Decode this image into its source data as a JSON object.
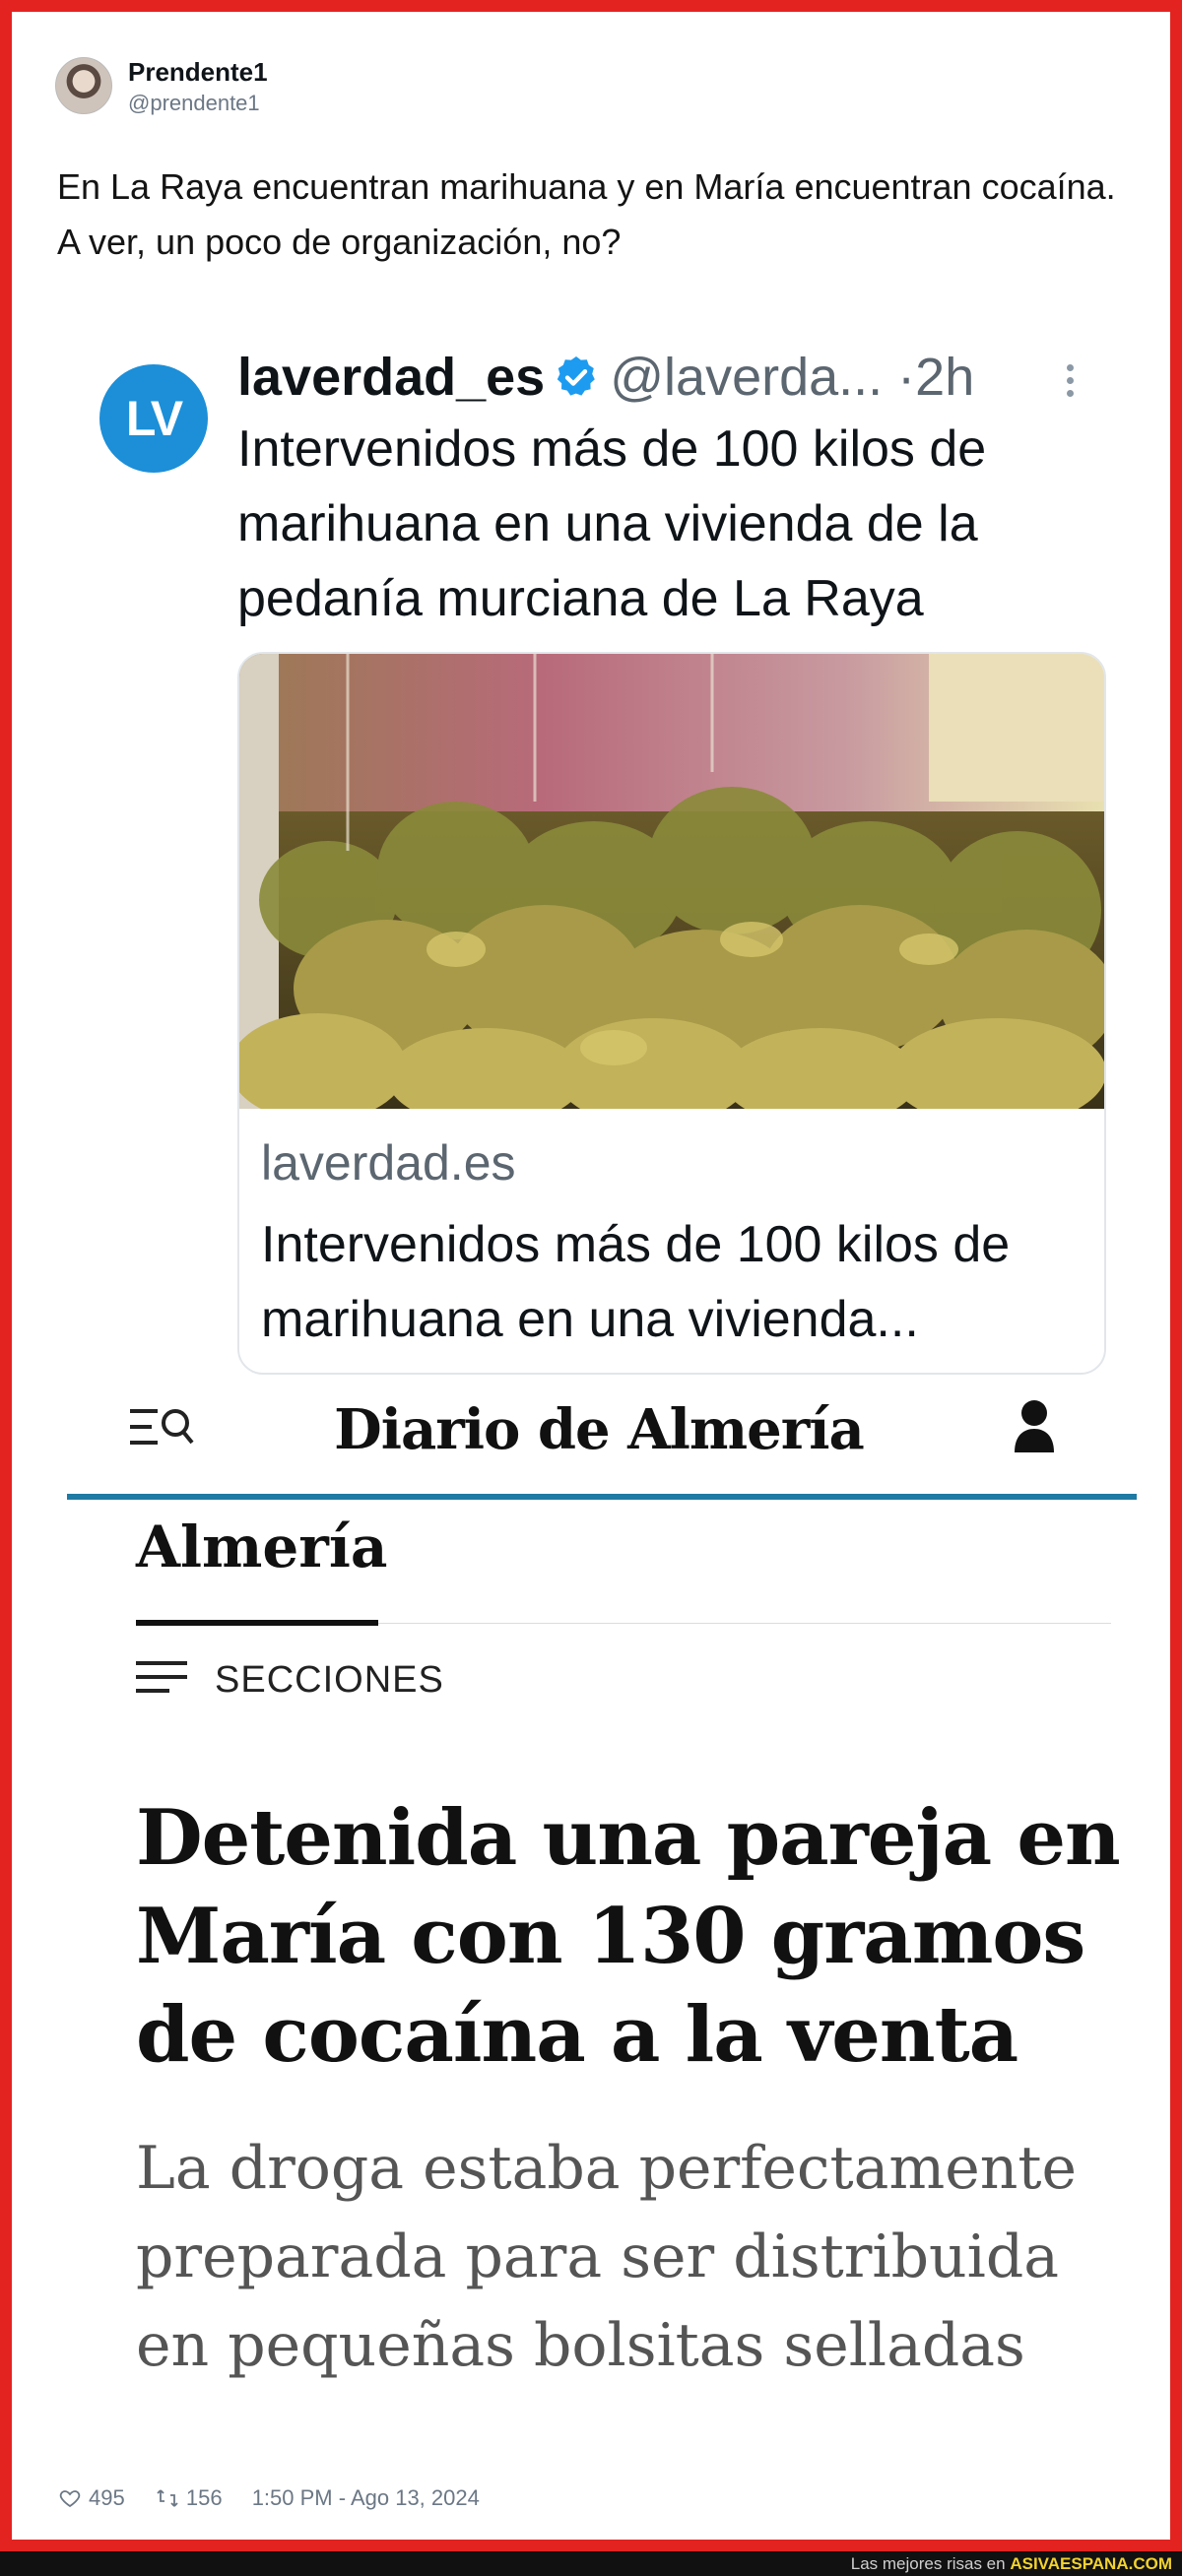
{
  "tweet": {
    "author_name": "Prendente1",
    "author_handle": "@prendente1",
    "text": "En La Raya encuentran marihuana y en María encuentran cocaína. A ver, un poco de organización, no?",
    "likes": "495",
    "retweets": "156",
    "timestamp": "1:50 PM - Ago 13, 2024"
  },
  "quoted_tweet": {
    "logo_text": "LV",
    "username": "laverdad_es",
    "handle": "@laverda...",
    "separator": "·",
    "time": "2h",
    "text": "Intervenidos más de 100 kilos de marihuana en una vivienda de la pedanía murciana de La Raya",
    "link_domain": "laverdad.es",
    "link_title": "Intervenidos más de 100 kilos de marihuana en una vivienda..."
  },
  "article": {
    "masthead": "Diario de Almería",
    "section": "Almería",
    "sections_label": "SECCIONES",
    "headline": "Detenida una pareja en María con 130 gramos de cocaína a la venta",
    "subheadline": "La droga estaba perfectamente preparada para ser distribuida en pequeñas bolsitas selladas"
  },
  "watermark": {
    "prefix": "Las mejores risas en",
    "brand": "ASIVAESPANA.COM"
  },
  "colors": {
    "frame": "#e32320",
    "lv_blue": "#1c8fd8",
    "verified_blue": "#1d9bf0",
    "diario_rule": "#1f7aa4",
    "watermark_brand": "#f2d22e"
  }
}
